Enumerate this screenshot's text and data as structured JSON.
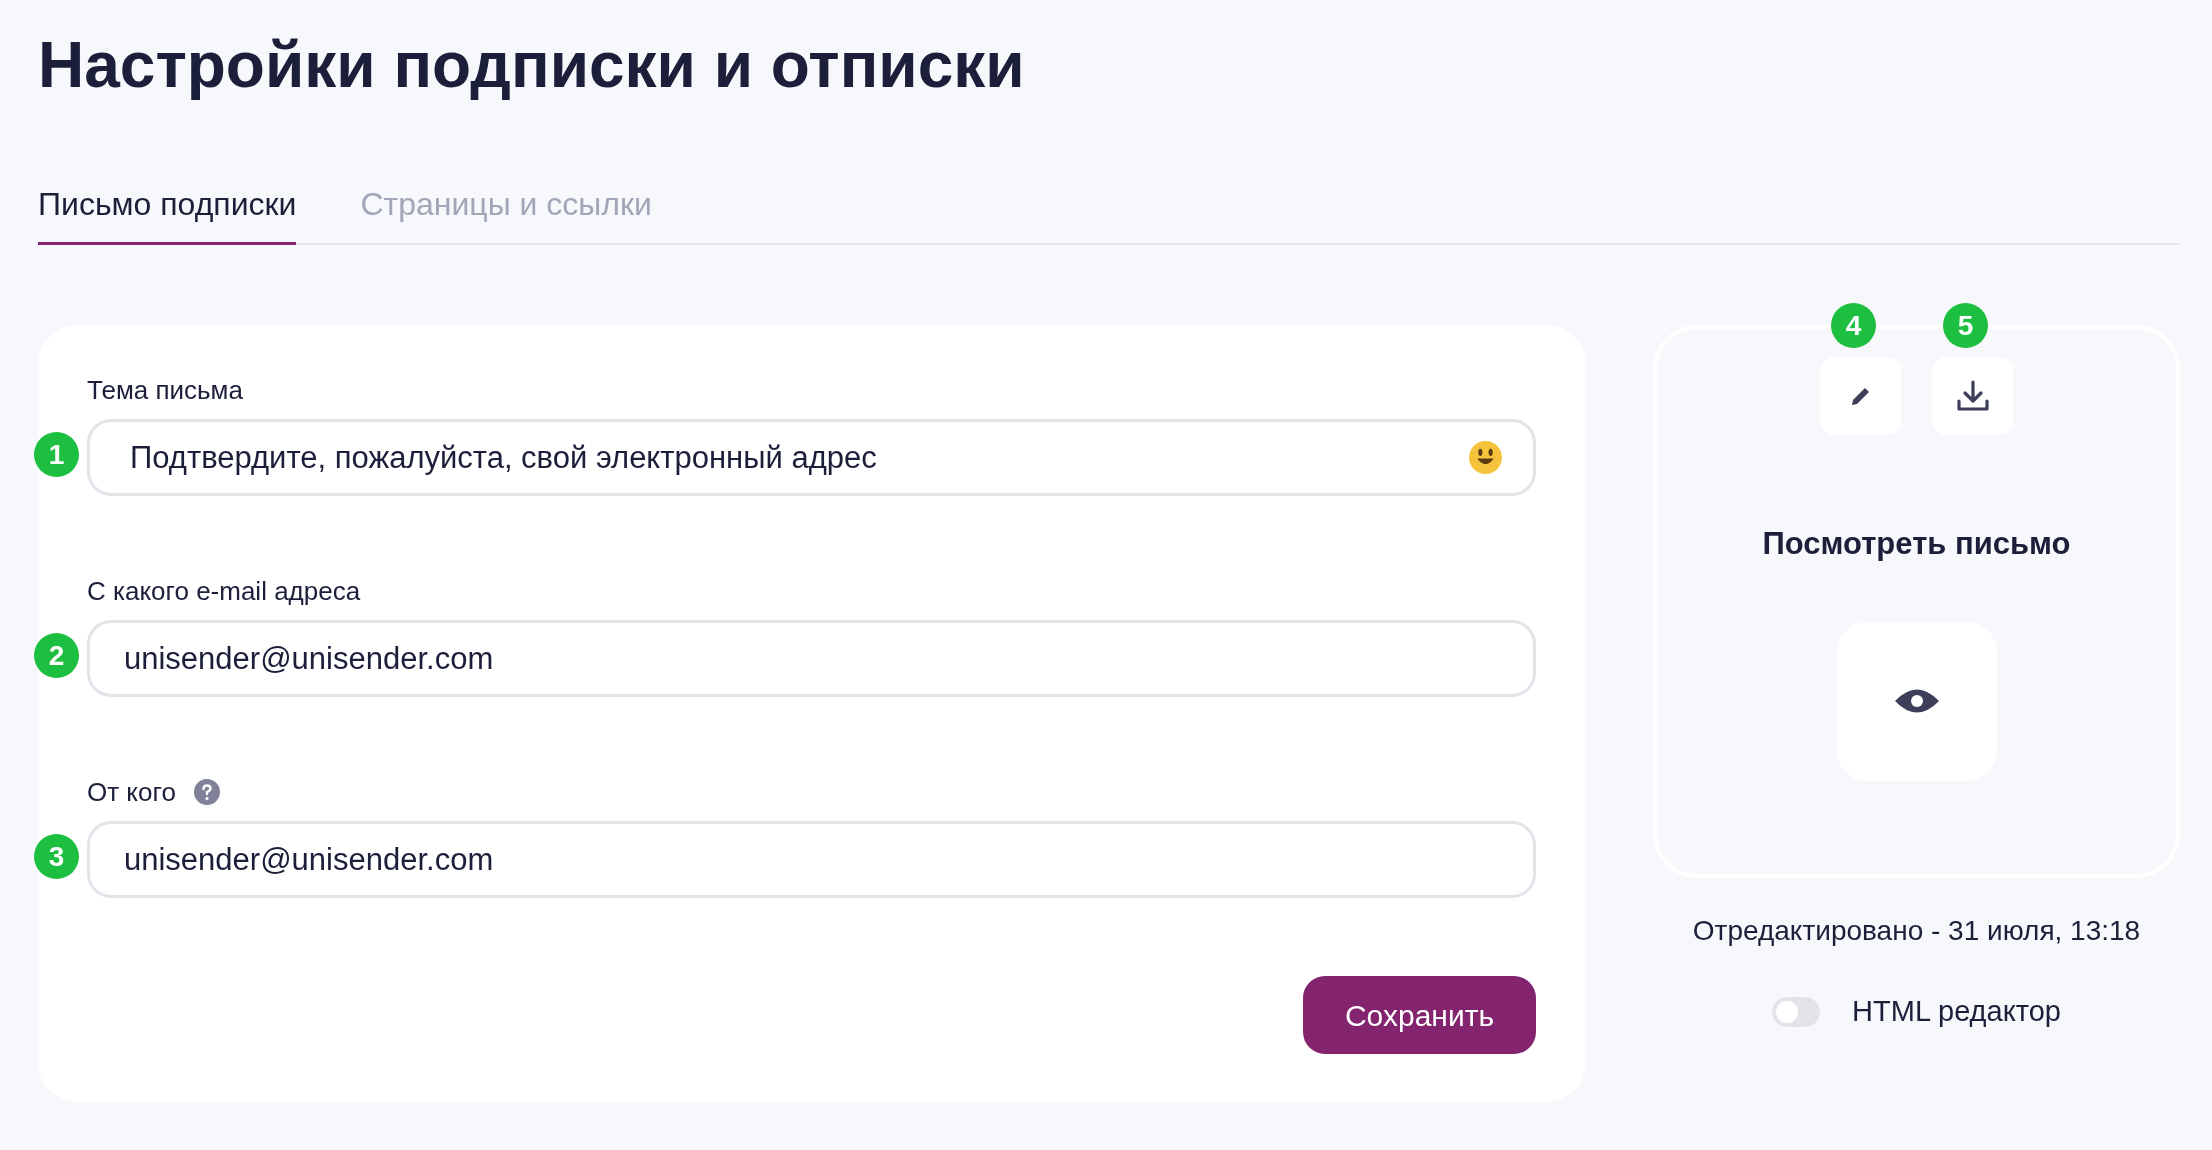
{
  "page": {
    "title": "Настройки подписки и отписки"
  },
  "tabs": [
    {
      "label": "Письмо подписки",
      "selected": true
    },
    {
      "label": "Страницы и ссылки",
      "selected": false
    }
  ],
  "form": {
    "fields": [
      {
        "label": "Тема письма",
        "value": "Подтвердите, пожалуйста, свой электронный адрес",
        "marker": "1",
        "has_help": false,
        "emoji_button": true
      },
      {
        "label": "С какого e-mail адреса",
        "value": "unisender@unisender.com",
        "marker": "2",
        "has_help": false,
        "emoji_button": false
      },
      {
        "label": "От кого",
        "value": "unisender@unisender.com",
        "marker": "3",
        "has_help": true,
        "emoji_button": false
      }
    ],
    "save_button": "Сохранить"
  },
  "preview": {
    "actions": [
      {
        "kind": "edit",
        "marker": "4"
      },
      {
        "kind": "download",
        "marker": "5"
      }
    ],
    "title": "Посмотреть письмо",
    "edited": "Отредактировано - 31 июля, 13:18",
    "html_editor": {
      "label": "HTML редактор",
      "on": false
    }
  }
}
